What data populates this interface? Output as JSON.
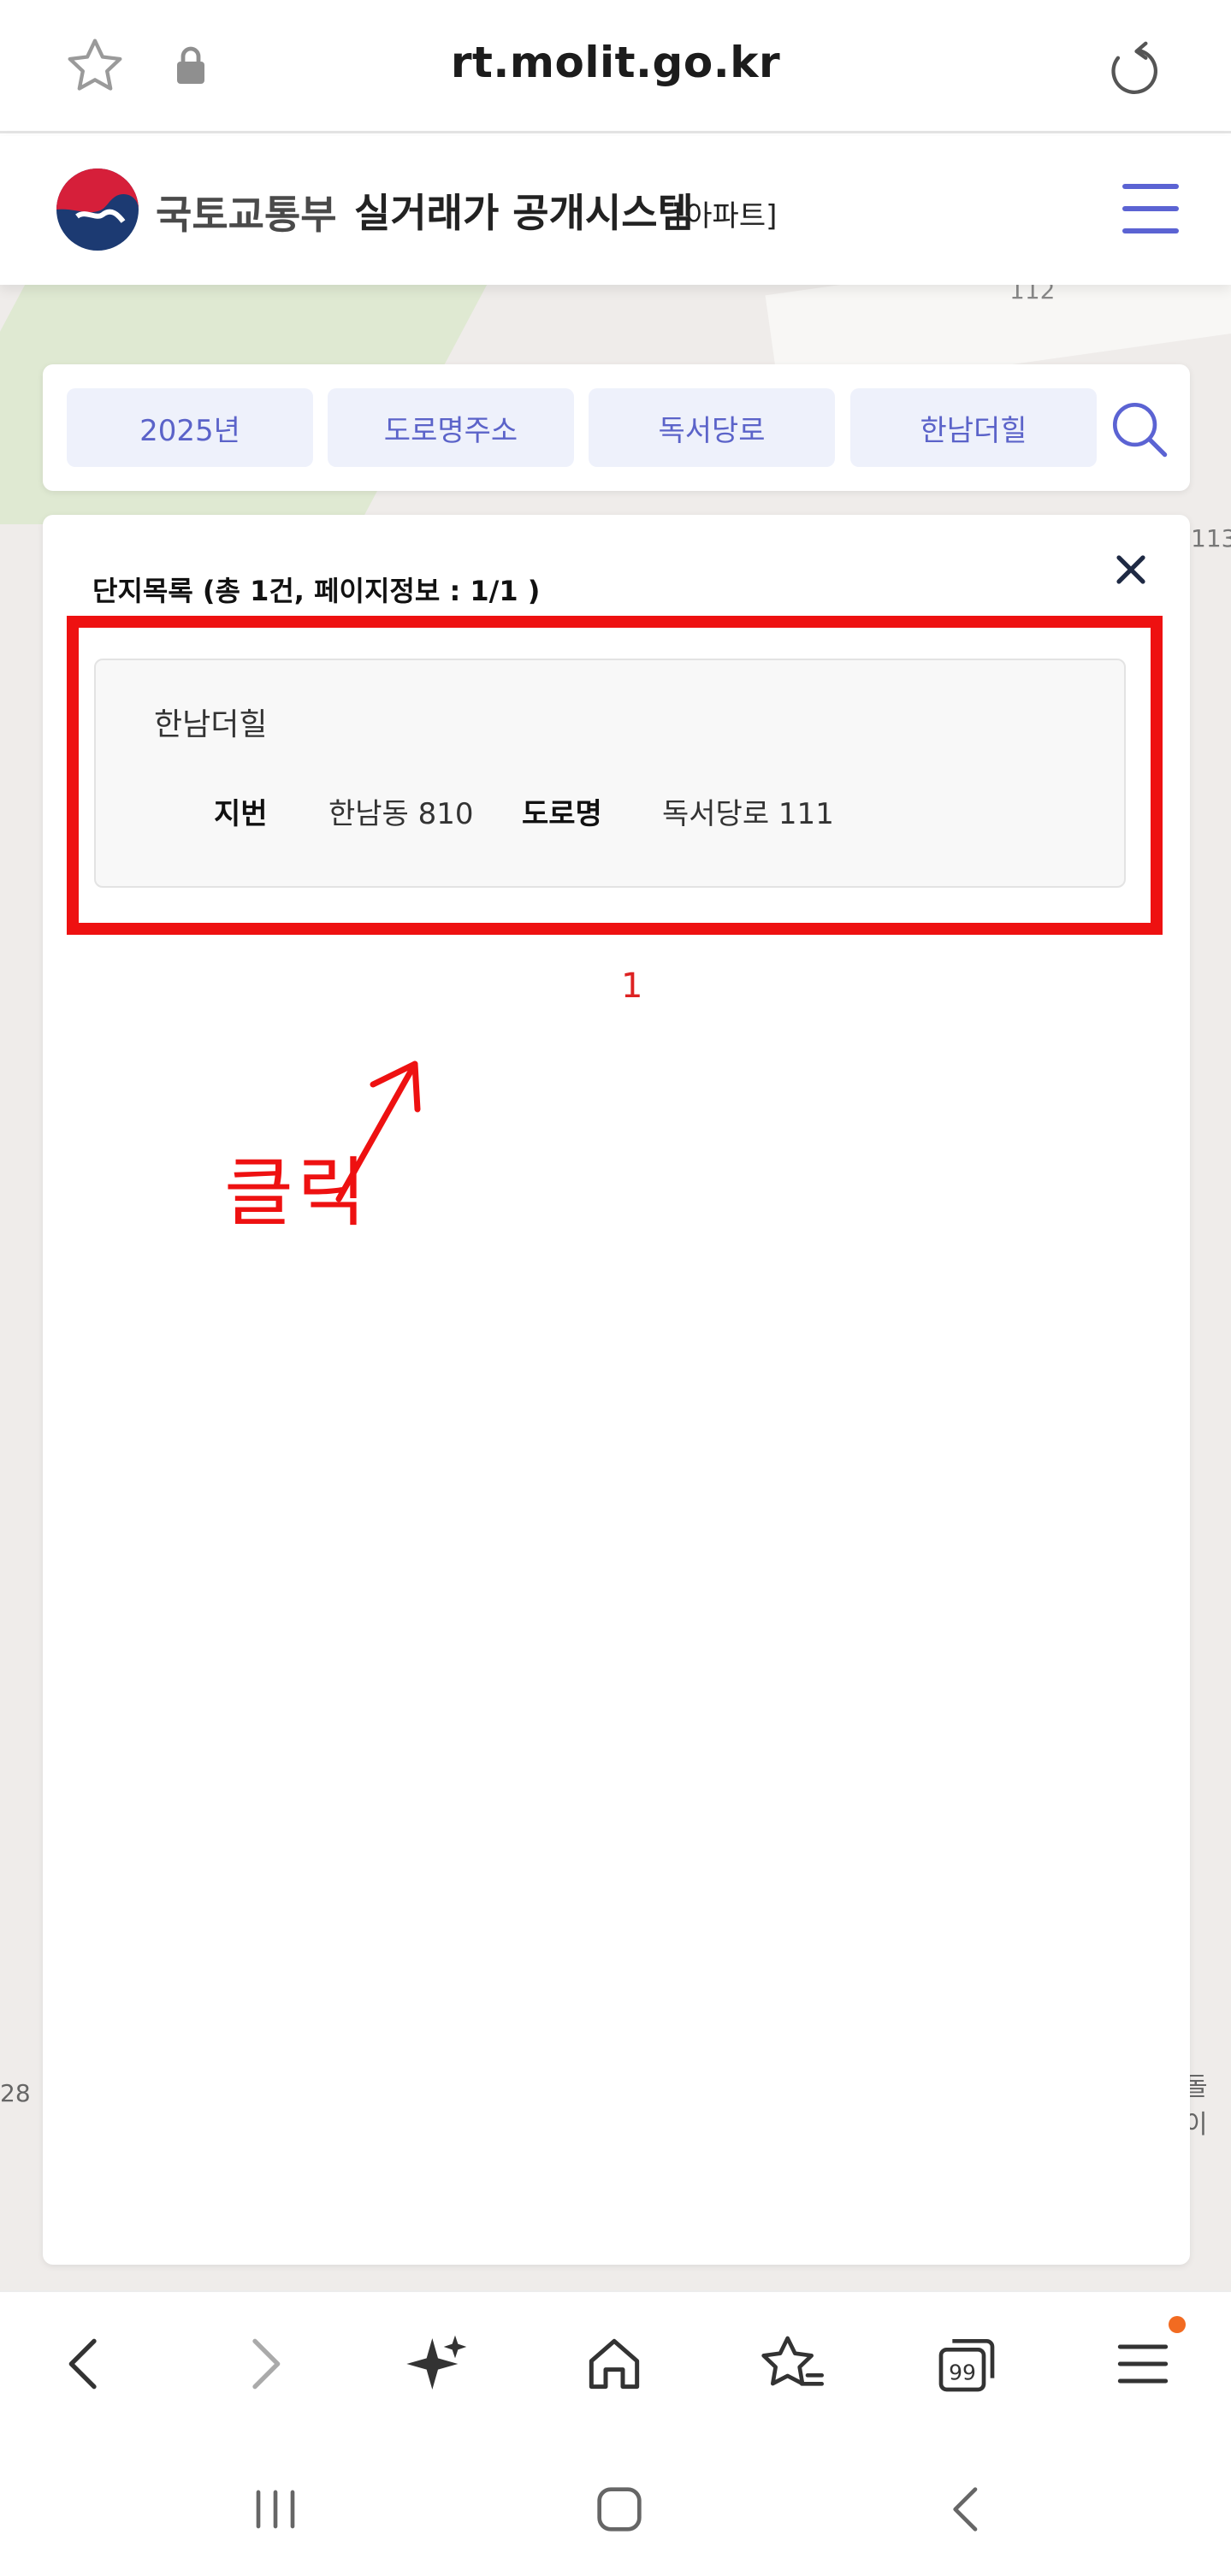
{
  "browser": {
    "url": "rt.molit.go.kr",
    "icons": [
      "star-icon",
      "lock-icon",
      "reload-icon"
    ]
  },
  "header": {
    "ministry": "국토교통부",
    "system_title": "실거래가 공개시스템",
    "subtype": "[아파트]",
    "icons": [
      "emblem-icon",
      "menu-icon"
    ],
    "colors": {
      "accent": "#5b63d3"
    }
  },
  "search": {
    "chips": [
      {
        "label": "2025년"
      },
      {
        "label": "도로명주소"
      },
      {
        "label": "독서당로"
      },
      {
        "label": "한남더힐"
      }
    ],
    "icon": "search-icon"
  },
  "results": {
    "title": "단지목록 (총 1건, 페이지정보 : 1/1 )",
    "items": [
      {
        "name": "한남더힐",
        "lot_label": "지번",
        "lot_value": "한남동 810",
        "road_label": "도로명",
        "road_value": "독서당로 111"
      }
    ],
    "page": "1"
  },
  "annotation": {
    "text": "클릭",
    "color": "#ee1111"
  },
  "map": {
    "labels": [
      "112",
      "113",
      "28",
      "돌이"
    ]
  },
  "toolbar": {
    "icons": [
      "back-icon",
      "forward-icon",
      "ai-sparkle-icon",
      "home-icon",
      "bookmarks-icon",
      "tabs-icon",
      "menu-icon"
    ],
    "tabs_count": "99"
  },
  "navbar": {
    "icons": [
      "recents-icon",
      "home-button-icon",
      "back-nav-icon"
    ]
  }
}
